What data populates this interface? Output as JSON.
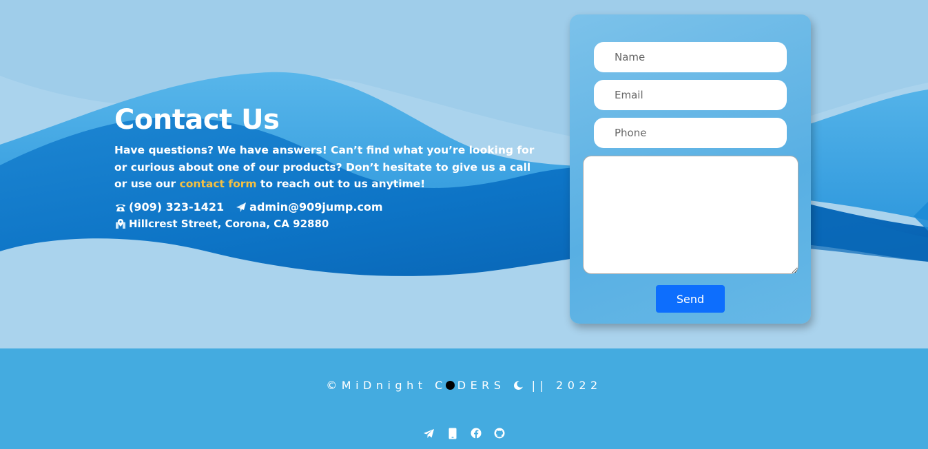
{
  "hero": {
    "title": "Contact Us",
    "description_part1": "Have questions? We have answers! Can’t find what you’re looking for or curious about one of our products? Don’t hesitate to give us a call or use our ",
    "link_text": "contact form",
    "description_part2": " to reach out to us anytime!",
    "phone": "(909) 323-1421",
    "email": "admin@909jump.com",
    "address": "Hillcrest Street, Corona, CA 92880",
    "icons": {
      "phone": "phone-icon",
      "email": "paper-plane-icon",
      "address": "map-pin-icon"
    }
  },
  "form": {
    "name_placeholder": "Name",
    "email_placeholder": "Email",
    "phone_placeholder": "Phone",
    "message_value": "",
    "send_label": "Send"
  },
  "footer": {
    "copyright_part1": "©MiDnight C",
    "copyright_part2": "DERS",
    "copyright_part3": "|| 2022",
    "socials": [
      "telegram-icon",
      "mobile-icon",
      "facebook-icon",
      "github-icon"
    ]
  },
  "colors": {
    "background": "#9fcdea",
    "wave_dark": "#0a67b3",
    "wave_mid": "#2a95dc",
    "accent_link": "#f5c042",
    "footer_bg": "#44abe0",
    "button_bg": "#0d6efd"
  }
}
